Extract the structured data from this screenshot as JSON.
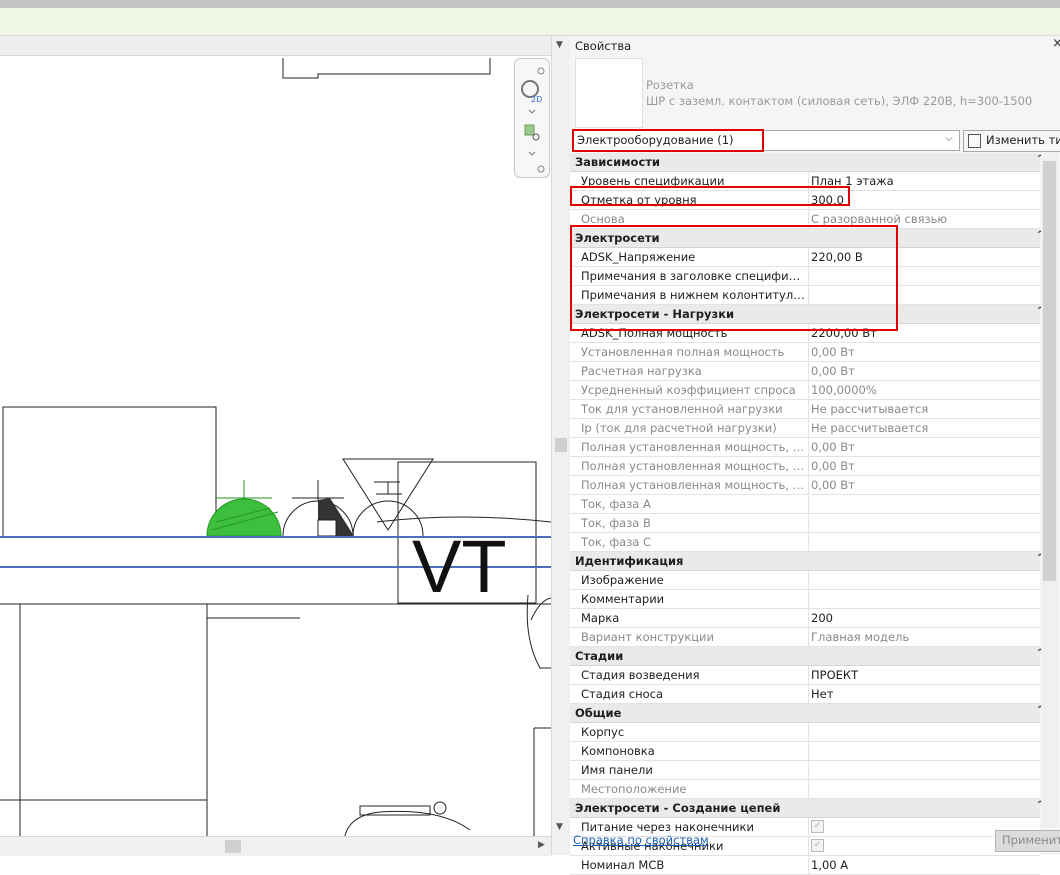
{
  "drawing": {
    "tag_text": "VT"
  },
  "panel": {
    "title": "Свойства",
    "close": "×",
    "family_name": "Розетка",
    "family_type": "ШР с заземл. контактом (силовая сеть), ЭЛФ 220В, h=300-1500",
    "type_selector": "Электрооборудование (1)",
    "edit_type": "Изменить тип",
    "help_link": "Справка по свойствам",
    "apply": "Применить",
    "groups": [
      {
        "name": "Зависимости",
        "rows": [
          {
            "k": "Уровень спецификации",
            "v": "План 1 этажа"
          },
          {
            "k": "Отметка от уровня",
            "v": "300,0"
          },
          {
            "k": "Основа",
            "v": "С разорванной связью",
            "ro": true
          }
        ]
      },
      {
        "name": "Электросети",
        "rows": [
          {
            "k": "ADSK_Напряжение",
            "v": "220,00 В"
          },
          {
            "k": "Примечания в заголовке спецификации",
            "v": ""
          },
          {
            "k": "Примечания в нижнем колонтитуле с...",
            "v": ""
          }
        ]
      },
      {
        "name": "Электросети - Нагрузки",
        "rows": [
          {
            "k": "ADSK_Полная мощность",
            "v": "2200,00 Вт"
          },
          {
            "k": "Установленная полная мощность",
            "v": "0,00 Вт",
            "ro": true
          },
          {
            "k": "Расчетная нагрузка",
            "v": "0,00 Вт",
            "ro": true
          },
          {
            "k": "Усредненный коэффициент спроса",
            "v": "100,0000%",
            "ro": true
          },
          {
            "k": "Ток для установленной нагрузки",
            "v": "Не рассчитывается",
            "ro": true
          },
          {
            "k": "Ip (ток для расчетной нагрузки)",
            "v": "Не рассчитывается",
            "ro": true
          },
          {
            "k": "Полная установленная мощность, фаз...",
            "v": "0,00 Вт",
            "ro": true
          },
          {
            "k": "Полная установленная мощность, фаз...",
            "v": "0,00 Вт",
            "ro": true
          },
          {
            "k": "Полная установленная мощность, фаз...",
            "v": "0,00 Вт",
            "ro": true
          },
          {
            "k": "Ток, фаза А",
            "v": "",
            "ro": true
          },
          {
            "k": "Ток, фаза В",
            "v": "",
            "ro": true
          },
          {
            "k": "Ток, фаза С",
            "v": "",
            "ro": true
          }
        ]
      },
      {
        "name": "Идентификация",
        "rows": [
          {
            "k": "Изображение",
            "v": ""
          },
          {
            "k": "Комментарии",
            "v": ""
          },
          {
            "k": "Марка",
            "v": "200"
          },
          {
            "k": "Вариант конструкции",
            "v": "Главная модель",
            "ro": true
          }
        ]
      },
      {
        "name": "Стадии",
        "rows": [
          {
            "k": "Стадия возведения",
            "v": "ПРОЕКТ"
          },
          {
            "k": "Стадия сноса",
            "v": "Нет"
          }
        ]
      },
      {
        "name": "Общие",
        "rows": [
          {
            "k": "Корпус",
            "v": ""
          },
          {
            "k": "Компоновка",
            "v": ""
          },
          {
            "k": "Имя панели",
            "v": ""
          },
          {
            "k": "Местоположение",
            "v": "",
            "ro": true
          }
        ]
      },
      {
        "name": "Электросети - Создание цепей",
        "rows": [
          {
            "k": "Питание через наконечники",
            "v": "",
            "check": true
          },
          {
            "k": "Активные наконечники",
            "v": "",
            "check": true
          },
          {
            "k": "Номинал МСВ",
            "v": "1,00 А"
          }
        ]
      }
    ]
  }
}
